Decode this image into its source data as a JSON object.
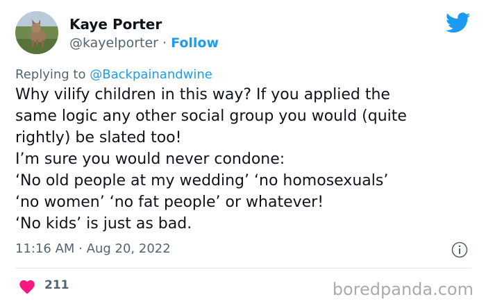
{
  "author": {
    "name": "Kaye Porter",
    "handle": "@kayelporter",
    "separator": "·",
    "follow_label": "Follow"
  },
  "reply": {
    "prefix": "Replying to",
    "to_handle": "@Backpainandwine"
  },
  "tweet": {
    "lines": [
      "Why vilify children in this way? If you applied the",
      "same logic any other social group you would (quite",
      "rightly) be slated too!",
      "I’m sure you would never condone:",
      "‘No old people at my wedding’ ‘no homosexuals’",
      "‘no women’ ‘no fat people’ or whatever!",
      "‘No kids’ is just as bad."
    ],
    "time": "11:16 AM",
    "separator": "·",
    "date": "Aug 20, 2022",
    "like_count": "211"
  },
  "watermark": "boredpanda.com",
  "colors": {
    "accent": "#1d9bf0",
    "heart": "#f91880",
    "secondary_text": "#536471"
  },
  "icons": [
    "avatar-photo",
    "twitter-bird-icon",
    "info-icon",
    "heart-icon"
  ]
}
